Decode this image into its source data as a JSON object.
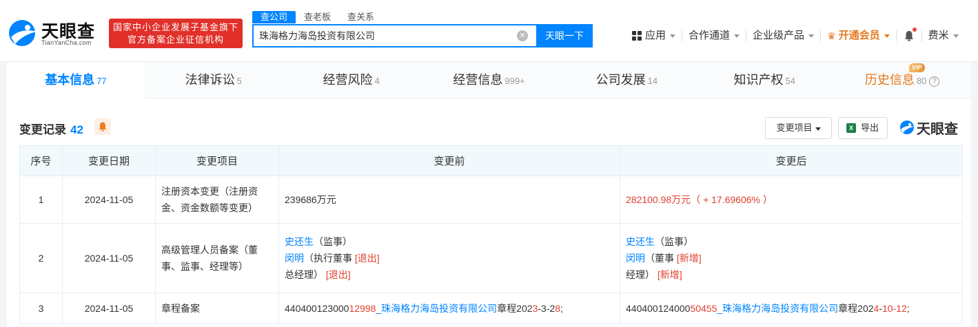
{
  "header": {
    "logo_text": "天眼查",
    "logo_sub": "TianYanCha.com",
    "gov_line1": "国家中小企业发展子基金旗下",
    "gov_line2": "官方备案企业征信机构",
    "search_tabs": [
      "查公司",
      "查老板",
      "查关系"
    ],
    "search_value": "珠海格力海岛投资有限公司",
    "search_button": "天眼一下",
    "nav": {
      "apps": "应用",
      "partners": "合作通道",
      "enterprise": "企业级产品",
      "vip": "开通会员",
      "user": "费米"
    }
  },
  "tabs": [
    {
      "label": "基本信息",
      "count": "77"
    },
    {
      "label": "法律诉讼",
      "count": "5"
    },
    {
      "label": "经营风险",
      "count": "4"
    },
    {
      "label": "经营信息",
      "count": "999+"
    },
    {
      "label": "公司发展",
      "count": "14"
    },
    {
      "label": "知识产权",
      "count": "54"
    },
    {
      "label": "历史信息",
      "count": "80",
      "badge": "VIP"
    }
  ],
  "section": {
    "title": "变更记录",
    "count": "42",
    "filter_label": "变更项目",
    "export_label": "导出",
    "watermark": "天眼查"
  },
  "table": {
    "headers": [
      "序号",
      "变更日期",
      "变更项目",
      "变更前",
      "变更后"
    ],
    "rows": [
      {
        "index": "1",
        "date": "2024-11-05",
        "item": "注册资本变更（注册资金、资金数额等变更）",
        "before": "239686万元",
        "after": "282100.98万元（ + 17.69606% ）"
      },
      {
        "index": "2",
        "date": "2024-11-05",
        "item": "高级管理人员备案（董事、监事、经理等）",
        "before": {
          "p1_name": "史还生",
          "p1_role": "（监事）",
          "p2_name": "闵明",
          "p2_role": "（执行董事",
          "p2_tag": "[退出]",
          "p3_role": "总经理）",
          "p3_tag": "[退出]"
        },
        "after": {
          "p1_name": "史还生",
          "p1_role": "（监事）",
          "p2_name": "闵明",
          "p2_role": "（董事",
          "p2_tag": "[新增]",
          "p3_role": "经理）",
          "p3_tag": "[新增]"
        }
      },
      {
        "index": "3",
        "date": "2024-11-05",
        "item": "章程备案",
        "before": {
          "code_a": "440400123",
          "code_b": "000",
          "code_c": "12998",
          "company": "_珠海格力海岛投资有限公司",
          "suffix_a": "章程202",
          "suffix_b": "3",
          "suffix_c": "-3-2",
          "suffix_d": "8",
          "suffix_e": ";"
        },
        "after": {
          "code_a": "440400124",
          "code_b": "000",
          "code_c": "50455",
          "company": "_珠海格力海岛投资有限公司",
          "suffix_a": "章程202",
          "suffix_b": "4",
          "suffix_c": "-",
          "suffix_d": "10-12",
          "suffix_e": ";"
        }
      }
    ]
  },
  "colors": {
    "accent": "#0084ff",
    "vip": "#e5791d",
    "red": "#e0402f",
    "brand_red": "#e1302a"
  }
}
